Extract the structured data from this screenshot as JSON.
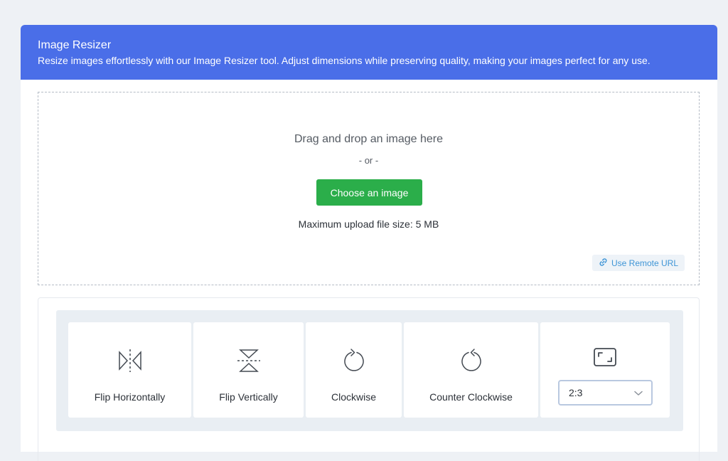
{
  "header": {
    "title": "Image Resizer",
    "subtitle": "Resize images effortlessly with our Image Resizer tool. Adjust dimensions while preserving quality, making your images perfect for any use."
  },
  "upload": {
    "drag_text": "Drag and drop an image here",
    "or_text": "- or -",
    "choose_button": "Choose an image",
    "max_size": "Maximum upload file size: 5 MB",
    "remote_url": "Use Remote URL",
    "remote_icon": "link-icon"
  },
  "tools": [
    {
      "label": "Flip Horizontally",
      "icon": "flip-horizontal-icon"
    },
    {
      "label": "Flip Vertically",
      "icon": "flip-vertical-icon"
    },
    {
      "label": "Clockwise",
      "icon": "rotate-clockwise-icon"
    },
    {
      "label": "Counter Clockwise",
      "icon": "rotate-counter-clockwise-icon"
    }
  ],
  "aspect_ratio": {
    "icon": "crop-aspect-icon",
    "selected": "2:3"
  },
  "colors": {
    "header_bg": "#4a6ee8",
    "choose_button_bg": "#2bae4a",
    "link_color": "#3f95d6",
    "page_bg": "#eef1f5"
  }
}
